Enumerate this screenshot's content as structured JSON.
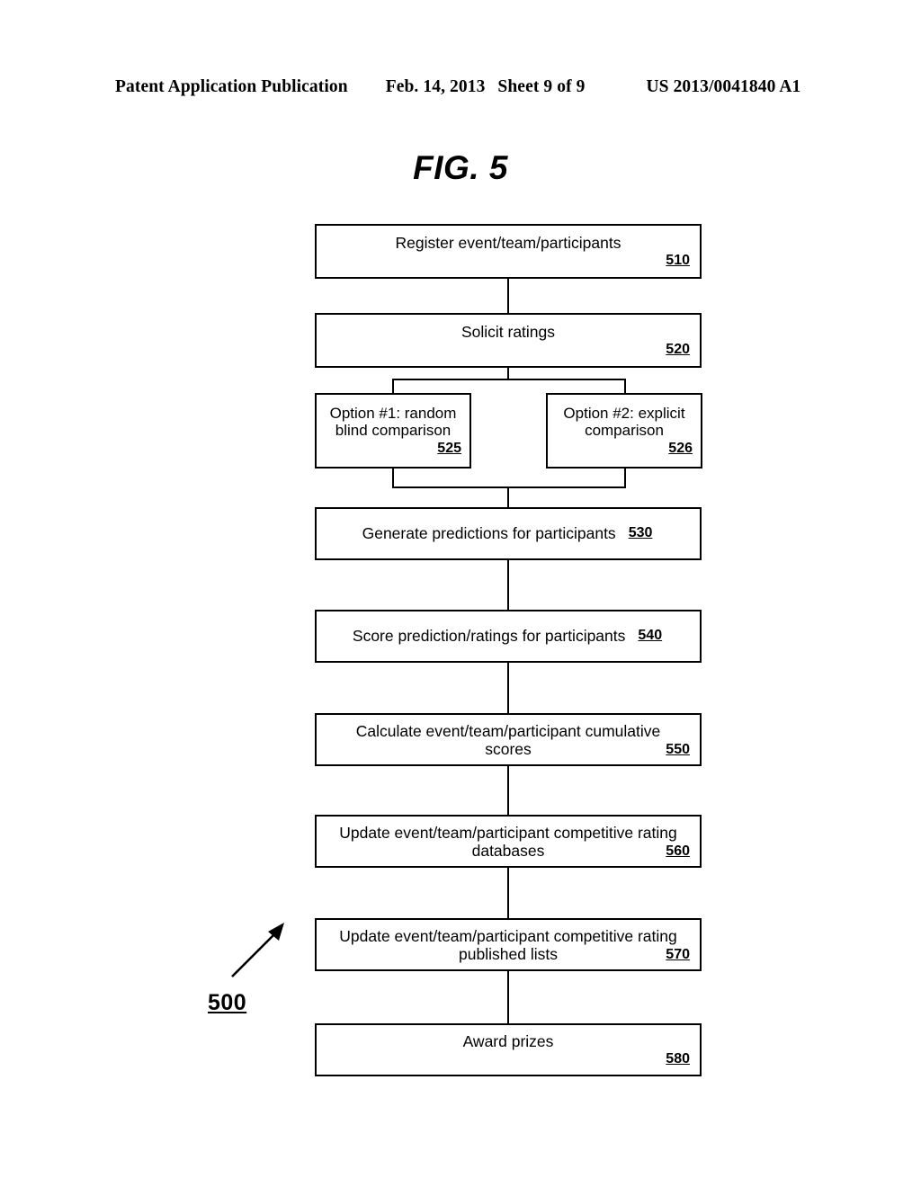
{
  "header": {
    "publication": "Patent Application Publication",
    "date": "Feb. 14, 2013",
    "sheet": "Sheet 9 of 9",
    "pub_number": "US 2013/0041840 A1"
  },
  "figure": {
    "title": "FIG. 5",
    "diagram_ref": "500"
  },
  "flowchart": {
    "nodes": [
      {
        "id": "510",
        "label": "Register event/team/participants",
        "ref": "510"
      },
      {
        "id": "520",
        "label": "Solicit ratings",
        "ref": "520"
      },
      {
        "id": "525",
        "label": "Option #1: random\nblind comparison",
        "ref": "525"
      },
      {
        "id": "526",
        "label": "Option #2: explicit\ncomparison",
        "ref": "526"
      },
      {
        "id": "530",
        "label": "Generate predictions for participants",
        "ref": "530"
      },
      {
        "id": "540",
        "label": "Score prediction/ratings for participants",
        "ref": "540"
      },
      {
        "id": "550",
        "label": "Calculate event/team/participant cumulative\nscores",
        "ref": "550"
      },
      {
        "id": "560",
        "label": "Update event/team/participant competitive rating\ndatabases",
        "ref": "560"
      },
      {
        "id": "570",
        "label": "Update event/team/participant competitive rating\npublished lists",
        "ref": "570"
      },
      {
        "id": "580",
        "label": "Award prizes",
        "ref": "580"
      }
    ]
  },
  "colors": {
    "ink": "#000000",
    "paper": "#ffffff"
  }
}
